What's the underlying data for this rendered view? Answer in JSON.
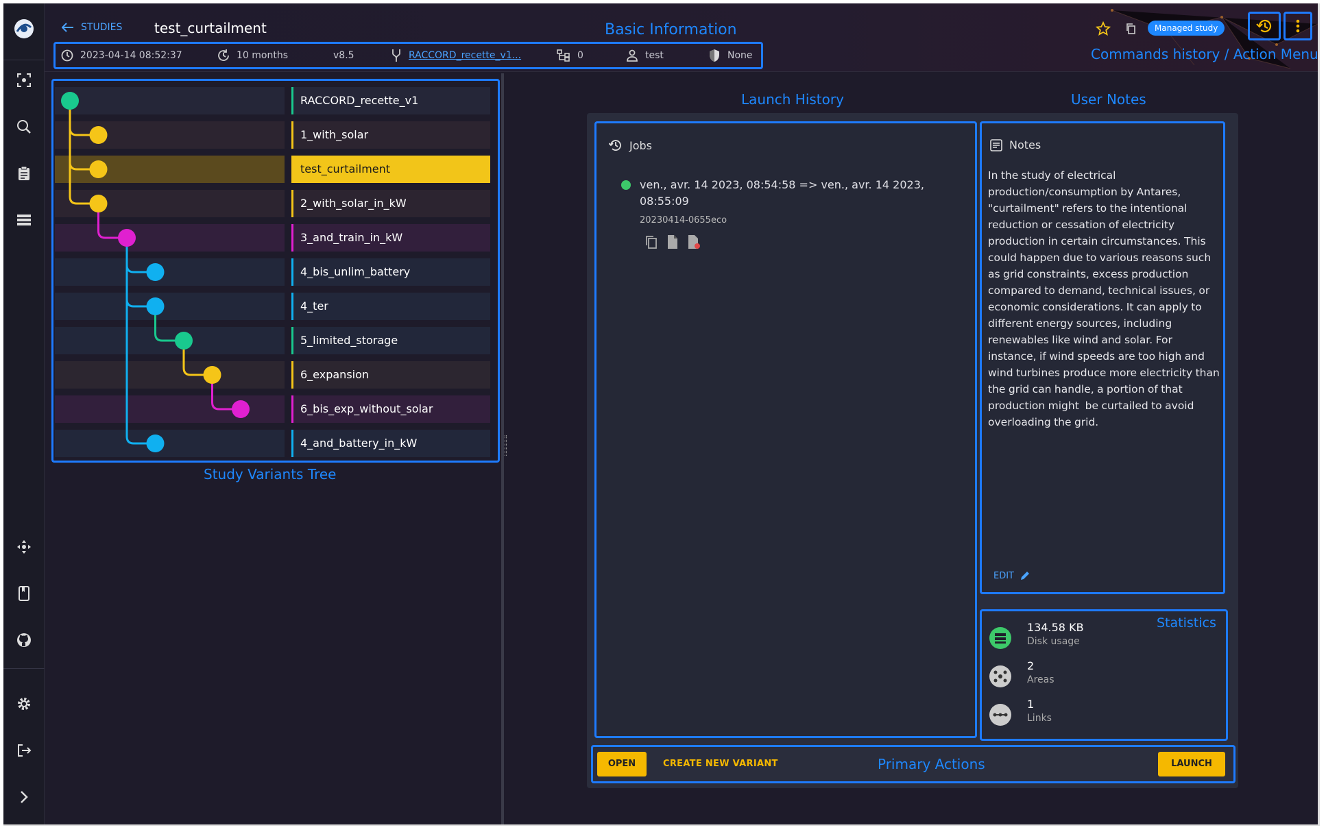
{
  "app": {
    "title": "test_curtailment"
  },
  "header": {
    "back_label": "STUDIES",
    "study_name": "test_curtailment",
    "basic_info_caption": "Basic Information",
    "date": "2023-04-14 08:52:37",
    "age": "10 months",
    "version": "v8.5",
    "parent_link": "RACCORD_recette_v1...",
    "variants_count": "0",
    "author": "test",
    "permission": "None",
    "managed_badge": "Managed study",
    "commands_caption": "Commands history / Action Menu"
  },
  "tree": {
    "caption": "Study Variants Tree",
    "items": [
      {
        "label": "RACCORD_recette_v1",
        "color": "#19c98e"
      },
      {
        "label": "1_with_solar",
        "color": "#f5c518"
      },
      {
        "label": "test_curtailment",
        "color": "#f5c518",
        "selected": true
      },
      {
        "label": "2_with_solar_in_kW",
        "color": "#f5c518"
      },
      {
        "label": "3_and_train_in_kW",
        "color": "#e020d0"
      },
      {
        "label": "4_bis_unlim_battery",
        "color": "#10b0f0"
      },
      {
        "label": "4_ter",
        "color": "#10b0f0"
      },
      {
        "label": "5_limited_storage",
        "color": "#19c98e"
      },
      {
        "label": "6_expansion",
        "color": "#f5c518"
      },
      {
        "label": "6_bis_exp_without_solar",
        "color": "#e020d0"
      },
      {
        "label": "4_and_battery_in_kW",
        "color": "#10b0f0"
      }
    ]
  },
  "launch": {
    "caption": "Launch History",
    "title": "Jobs",
    "job_dates": "ven., avr. 14 2023, 08:54:58 => ven., avr. 14 2023, 08:55:09",
    "job_id": "20230414-0655eco"
  },
  "notes": {
    "caption": "User Notes",
    "title": "Notes",
    "text": "In the study of electrical production/consumption by Antares, \"curtailment\" refers to the intentional reduction or cessation of electricity production in certain circumstances. This could happen due to various reasons such as grid constraints, excess production compared to demand, technical issues, or economic considerations. It can apply to  different energy sources, including renewables like wind and solar. For  instance, if wind speeds are too high and wind turbines produce more electricity than the grid can handle, a portion of that production might  be curtailed to avoid overloading the grid.",
    "edit_label": "EDIT"
  },
  "stats": {
    "caption": "Statistics",
    "disk_value": "134.58 KB",
    "disk_label": "Disk usage",
    "areas_value": "2",
    "areas_label": "Areas",
    "links_value": "1",
    "links_label": "Links"
  },
  "actions": {
    "open_label": "OPEN",
    "variant_label": "CREATE NEW VARIANT",
    "caption": "Primary Actions",
    "launch_label": "LAUNCH"
  }
}
